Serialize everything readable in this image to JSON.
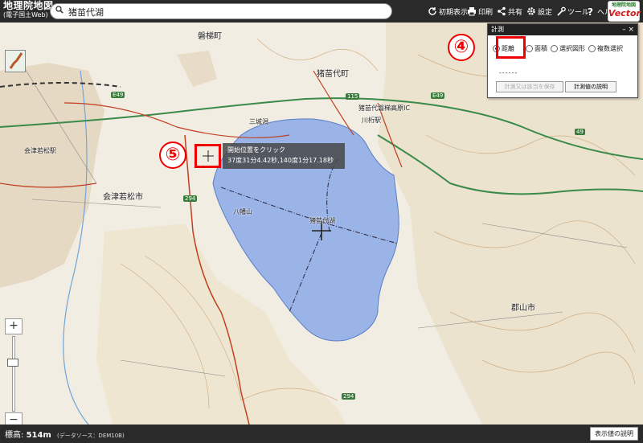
{
  "header": {
    "logo_title": "地理院地図",
    "logo_subtitle": "(電子国土Web)",
    "search_value": "猪苗代湖",
    "buttons": [
      {
        "label": "初期表示",
        "icon": "refresh-icon"
      },
      {
        "label": "印刷",
        "icon": "print-icon"
      },
      {
        "label": "共有",
        "icon": "share-icon"
      },
      {
        "label": "設定",
        "icon": "gear-icon"
      },
      {
        "label": "ツール",
        "icon": "tool-icon"
      },
      {
        "label": "ヘルプ",
        "icon": "help-icon"
      }
    ],
    "badge_top": "地理院地図",
    "badge_main": "Vector"
  },
  "panel": {
    "title": "計測",
    "controls": "–  ×",
    "options": [
      {
        "label": "距離",
        "selected": true
      },
      {
        "label": "面積",
        "selected": false
      },
      {
        "label": "選択図形",
        "selected": false
      },
      {
        "label": "複数選択",
        "selected": false
      }
    ],
    "result": "------",
    "save_button": "計測又は該当を保存",
    "explain_button": "計測値の説明"
  },
  "tooltip": {
    "line1": "開始位置をクリック",
    "line2": "37度31分4.42秒,140度1分17.18秒"
  },
  "steps": [
    "④",
    "⑤"
  ],
  "map_labels": {
    "lake": "猪苗代湖",
    "inawashiro_town": "猪苗代町",
    "aizuwakamatsu_city": "会津若松市",
    "koriyama_city": "郡山市",
    "bandai_town": "磐梯町",
    "inawashiro_ic": "猪苗代磐梯高原IC",
    "aizuwakamatsu_station": "会津若松駅",
    "hoshiyama": "八幡山",
    "senjo": "三城潟",
    "kawahigashi": "川桁駅",
    "e49": "E49",
    "r294": "294",
    "r49": "49",
    "r115": "115"
  },
  "zoom": {
    "plus": "+",
    "minus": "−"
  },
  "footer": {
    "elevation_label": "標高:",
    "elevation_value": "514m",
    "source": "(データソース：DEM10B)",
    "explain_button": "表示値の説明"
  }
}
